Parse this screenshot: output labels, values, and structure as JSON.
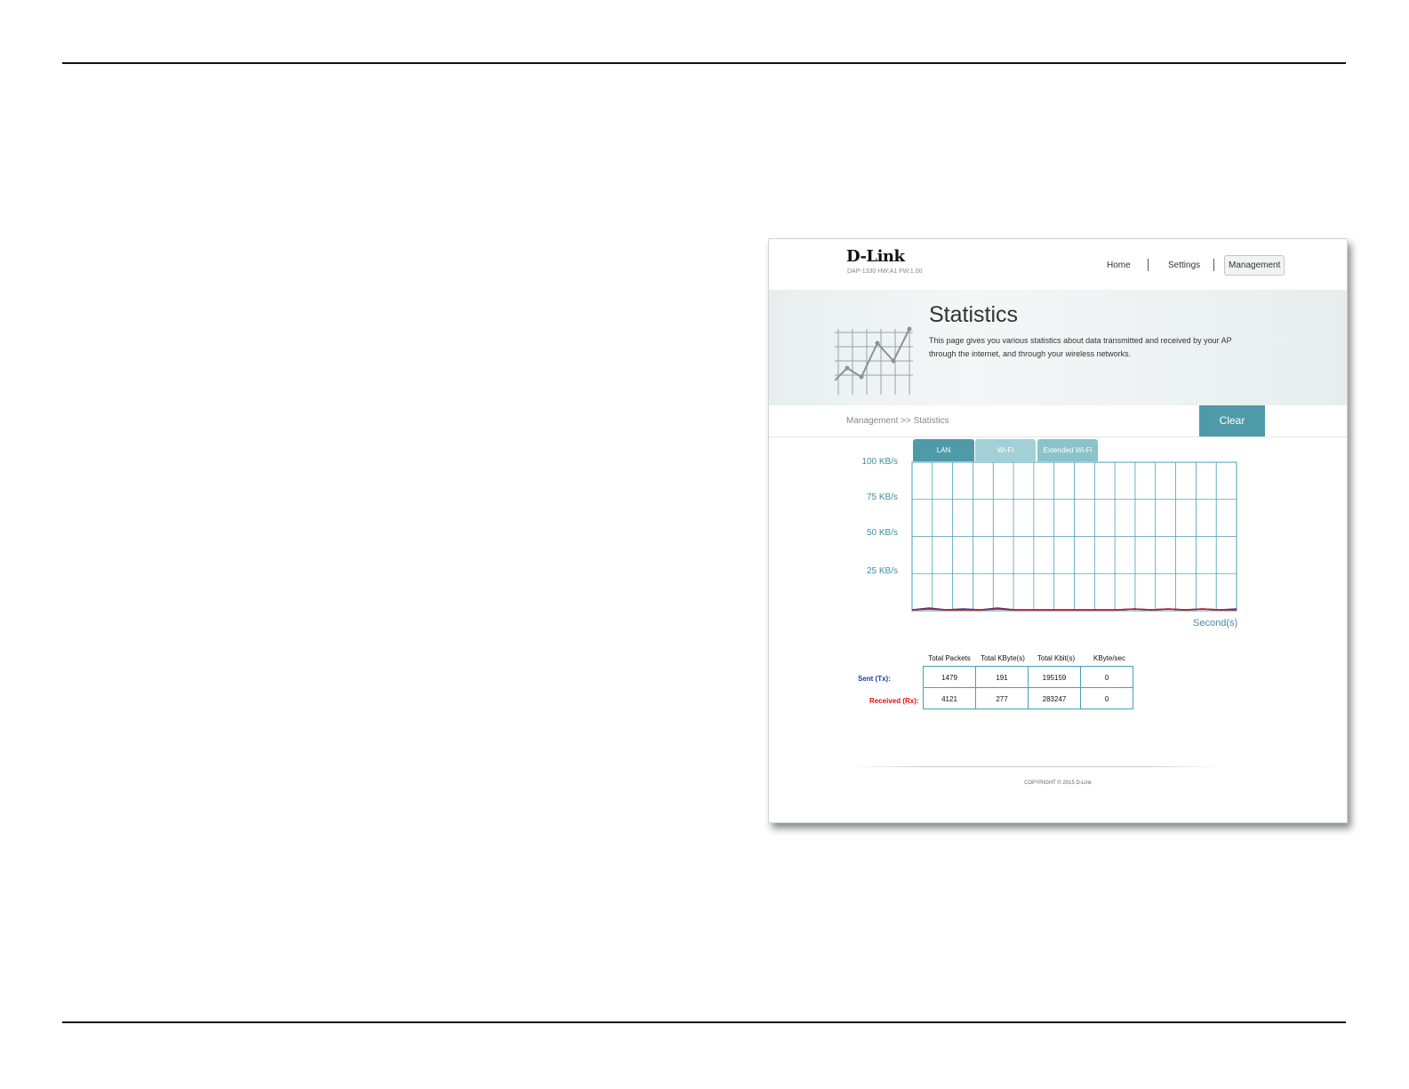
{
  "header": {
    "logo": "D-Link",
    "model_info": "DAP-1330   HW:A1   FW:1.00",
    "nav": {
      "home": "Home",
      "settings": "Settings",
      "management": "Management"
    }
  },
  "banner": {
    "title": "Statistics",
    "description": "This page gives you various statistics about data transmitted and received by your AP through the internet, and through your wireless networks."
  },
  "breadcrumb": "Management >> Statistics",
  "clear_button": "Clear",
  "tabs": [
    "LAN",
    "Wi-Fi",
    "Extended Wi-Fi"
  ],
  "chart": {
    "y_labels": [
      "100 KB/s",
      "75 KB/s",
      "50 KB/s",
      "25 KB/s"
    ],
    "x_unit": "Second(s)",
    "colors": {
      "grid": "#4a9fb7",
      "sent": "#1d3c9b",
      "received": "#e01212"
    }
  },
  "chart_data": {
    "type": "line",
    "ylim": [
      0,
      100
    ],
    "ylabel": "KB/s",
    "xlabel": "Second(s)",
    "series": [
      {
        "name": "Sent (Tx)",
        "values": [
          0.0,
          0.2,
          0.0,
          0.1,
          0.0,
          0.2,
          0.0,
          0.0,
          0.0,
          0.0,
          0.0,
          0.0,
          0.0,
          0.1,
          0.0,
          0.1,
          0.0,
          0.1,
          0.0,
          0.1
        ]
      },
      {
        "name": "Received (Rx)",
        "values": [
          0.0,
          0.1,
          0.0,
          0.0,
          0.0,
          0.1,
          0.0,
          0.0,
          0.0,
          0.0,
          0.0,
          0.0,
          0.0,
          0.1,
          0.0,
          0.1,
          0.0,
          0.1,
          0.0,
          0.0
        ]
      }
    ]
  },
  "stats_table": {
    "columns": [
      "Total Packets",
      "Total KByte(s)",
      "Total Kbit(s)",
      "KByte/sec"
    ],
    "rows": [
      {
        "label": "Sent (Tx):",
        "values": [
          "1479",
          "191",
          "195159",
          "0"
        ]
      },
      {
        "label": "Received (Rx):",
        "values": [
          "4121",
          "277",
          "283247",
          "0"
        ]
      }
    ]
  },
  "footer": {
    "copyright": "COPYRIGHT © 2015 D-Link"
  }
}
